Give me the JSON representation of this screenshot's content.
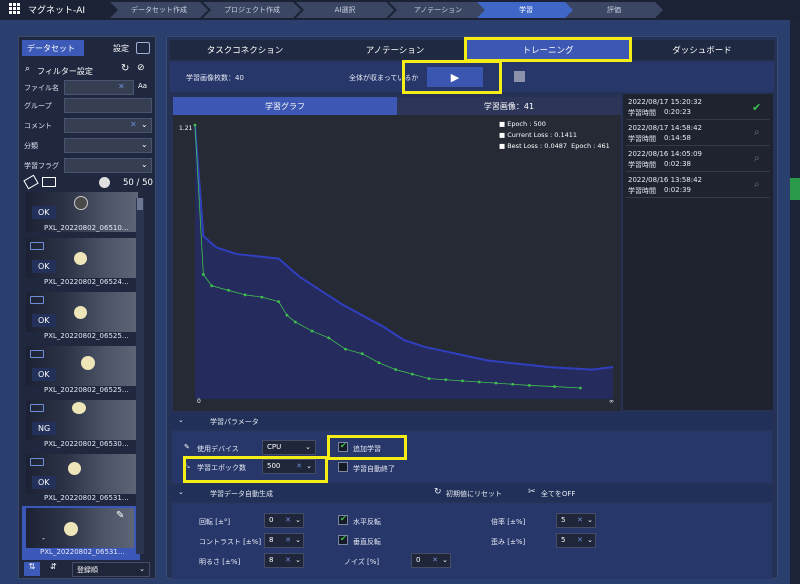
{
  "app": {
    "title": "マグネット-AI"
  },
  "steps": [
    {
      "label": "データセット作成"
    },
    {
      "label": "プロジェクト作成"
    },
    {
      "label": "AI選択"
    },
    {
      "label": "アノテーション"
    },
    {
      "label": "学習"
    },
    {
      "label": "評価"
    }
  ],
  "sidebar": {
    "tab_dataset": "データセット",
    "tab_settings": "設定",
    "filter_label": "フィルター設定",
    "fields": [
      {
        "label": "ファイル名"
      },
      {
        "label": "グループ"
      },
      {
        "label": "コメント"
      },
      {
        "label": "分類"
      },
      {
        "label": "学習フラグ"
      }
    ],
    "count": "50 / 50",
    "thumbs": [
      {
        "badge": "OK",
        "name": "PXL_20220802_06510…"
      },
      {
        "badge": "OK",
        "name": "PXL_20220802_06524…"
      },
      {
        "badge": "OK",
        "name": "PXL_20220802_06525…"
      },
      {
        "badge": "OK",
        "name": "PXL_20220802_06525…"
      },
      {
        "badge": "NG",
        "name": "PXL_20220802_06530…"
      },
      {
        "badge": "OK",
        "name": "PXL_20220802_06531…"
      },
      {
        "badge": "-",
        "name": "PXL_20220802_06531…"
      }
    ],
    "sort_value": "登録順"
  },
  "tabs": [
    {
      "label": "タスクコネクション"
    },
    {
      "label": "アノテーション"
    },
    {
      "label": "トレーニング"
    },
    {
      "label": "ダッシュボード"
    }
  ],
  "training": {
    "image_count": "学習画像枚数：40",
    "converged": "全体が収まっているか",
    "subtab_graph": "学習グラフ",
    "subtab_images": "学習画像：41"
  },
  "chart_data": {
    "type": "line",
    "y_top_label": "1.21",
    "x_start_label": "0",
    "x_end_label": "∞",
    "legend": {
      "epoch": "Epoch : 500",
      "current": "Current Loss : 0.1411",
      "best": "Best Loss : 0.0487",
      "best_epoch": "Epoch : 461"
    },
    "series": [
      {
        "color": "#2f3fc0",
        "values": [
          [
            0,
            1.21
          ],
          [
            10,
            0.72
          ],
          [
            25,
            0.67
          ],
          [
            50,
            0.64
          ],
          [
            75,
            0.63
          ],
          [
            100,
            0.62
          ],
          [
            125,
            0.54
          ],
          [
            150,
            0.48
          ],
          [
            175,
            0.42
          ],
          [
            200,
            0.37
          ],
          [
            225,
            0.32
          ],
          [
            250,
            0.26
          ],
          [
            275,
            0.23
          ],
          [
            300,
            0.21
          ],
          [
            325,
            0.19
          ],
          [
            350,
            0.17
          ],
          [
            375,
            0.16
          ],
          [
            400,
            0.15
          ],
          [
            425,
            0.14
          ],
          [
            450,
            0.135
          ],
          [
            475,
            0.13
          ],
          [
            500,
            0.1411
          ]
        ]
      },
      {
        "color": "#3fbf4f",
        "values": [
          [
            0,
            1.21
          ],
          [
            10,
            0.55
          ],
          [
            20,
            0.5
          ],
          [
            40,
            0.48
          ],
          [
            60,
            0.46
          ],
          [
            80,
            0.45
          ],
          [
            100,
            0.43
          ],
          [
            110,
            0.37
          ],
          [
            120,
            0.34
          ],
          [
            140,
            0.3
          ],
          [
            160,
            0.27
          ],
          [
            180,
            0.22
          ],
          [
            200,
            0.2
          ],
          [
            220,
            0.16
          ],
          [
            240,
            0.13
          ],
          [
            260,
            0.11
          ],
          [
            280,
            0.09
          ],
          [
            300,
            0.085
          ],
          [
            320,
            0.08
          ],
          [
            340,
            0.075
          ],
          [
            360,
            0.07
          ],
          [
            380,
            0.065
          ],
          [
            400,
            0.06
          ],
          [
            430,
            0.055
          ],
          [
            461,
            0.0487
          ]
        ]
      }
    ]
  },
  "history": [
    {
      "date": "2022/08/17 15:20:32",
      "time_label": "学習時間",
      "time": "0:20:23"
    },
    {
      "date": "2022/08/17 14:58:42",
      "time_label": "学習時間",
      "time": "0:14:58"
    },
    {
      "date": "2022/08/16 14:05:09",
      "time_label": "学習時間",
      "time": "0:02:38"
    },
    {
      "date": "2022/08/16 13:58:42",
      "time_label": "学習時間",
      "time": "0:02:39"
    }
  ],
  "params": {
    "title": "学習パラメータ",
    "device_label": "使用デバイス",
    "device_value": "CPU",
    "epoch_label": "学習エポック数",
    "epoch_value": "500",
    "additional": "追加学習",
    "auto_end": "学習自動終了"
  },
  "augment": {
    "title": "学習データ自動生成",
    "reset": "初期値にリセット",
    "all_off": "全てをOFF",
    "rotation_label": "回転 [±°]",
    "rotation_value": "0",
    "contrast_label": "コントラスト [±%]",
    "contrast_value": "8",
    "brightness_label": "明るさ [±%]",
    "brightness_value": "8",
    "hflip": "水平反転",
    "vflip": "垂直反転",
    "noise_label": "ノイズ [%]",
    "noise_value": "0",
    "scale_label": "倍率 [±%]",
    "scale_value": "5",
    "distort_label": "歪み [±%]",
    "distort_value": "5"
  }
}
